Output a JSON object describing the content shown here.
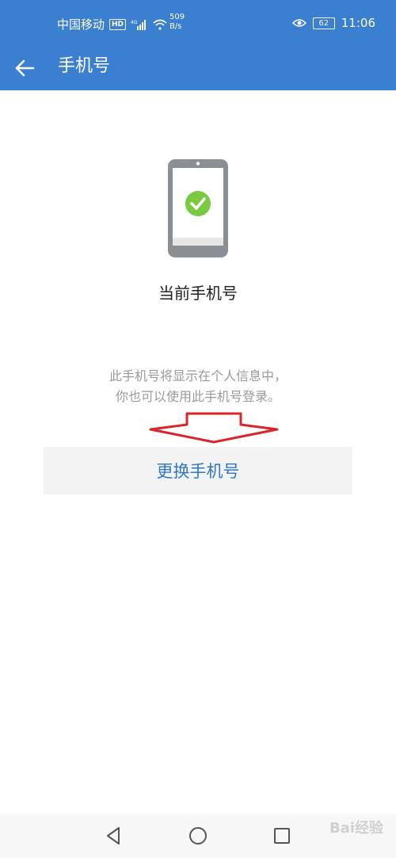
{
  "status_bar": {
    "carrier": "中国移动",
    "hd_badge": "HD",
    "net_speed_value": "509",
    "net_speed_unit": "B/s",
    "battery": "62",
    "time": "11:06"
  },
  "app_bar": {
    "title": "手机号"
  },
  "content": {
    "current_label": "当前手机号",
    "info_line1": "此手机号将显示在个人信息中，",
    "info_line2": "你也可以使用此手机号登录。",
    "change_button": "更换手机号"
  },
  "colors": {
    "primary": "#3b7fd0",
    "check_green": "#7ac943",
    "button_text": "#2f78c7",
    "annotation_red": "#d9252a"
  },
  "nav": {
    "watermark": "Bai经验"
  }
}
